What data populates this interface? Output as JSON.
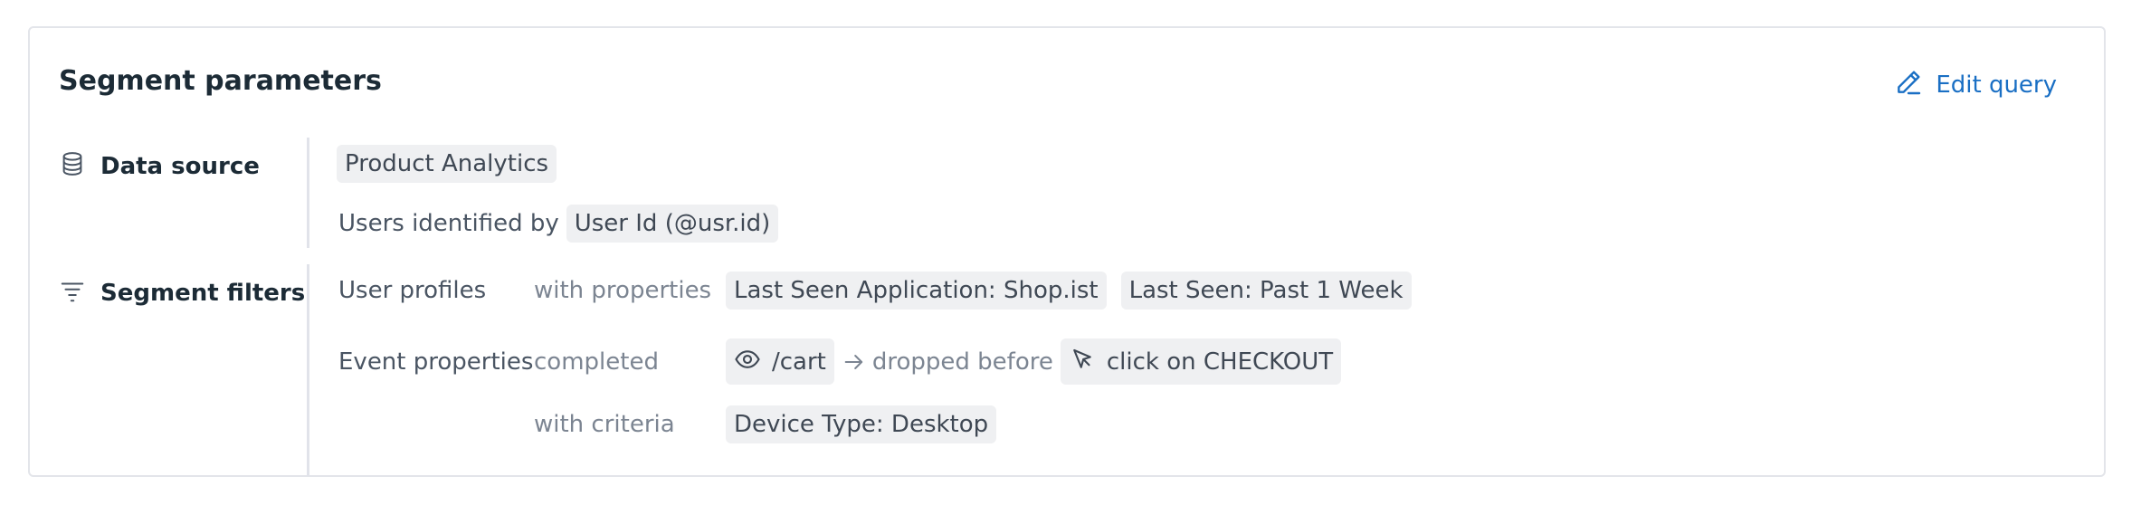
{
  "header": {
    "title": "Segment parameters",
    "edit_label": "Edit query"
  },
  "data_source": {
    "heading": "Data source",
    "source_chip": "Product Analytics",
    "identified_prefix": "Users identified by",
    "identified_chip": "User Id (@usr.id)"
  },
  "segment_filters": {
    "heading": "Segment filters",
    "user_profiles": {
      "label": "User profiles",
      "qualifier": "with properties",
      "chips": [
        "Last Seen Application: Shop.ist",
        "Last Seen: Past 1 Week"
      ]
    },
    "event_properties": {
      "label": "Event properties",
      "qualifier": "completed",
      "view_chip": "/cart",
      "connector": "dropped before",
      "action_chip": "click on CHECKOUT",
      "criteria_qualifier": "with criteria",
      "criteria_chip": "Device Type: Desktop"
    }
  },
  "icons": {
    "edit": "pencil-icon",
    "data_source": "database-icon",
    "filters": "filter-icon",
    "view": "eye-icon",
    "action": "cursor-icon",
    "connector": "arrow-right-icon"
  },
  "colors": {
    "accent": "#1a6fc4",
    "chip_bg": "#eff0f2",
    "border": "#e3e5ea"
  }
}
